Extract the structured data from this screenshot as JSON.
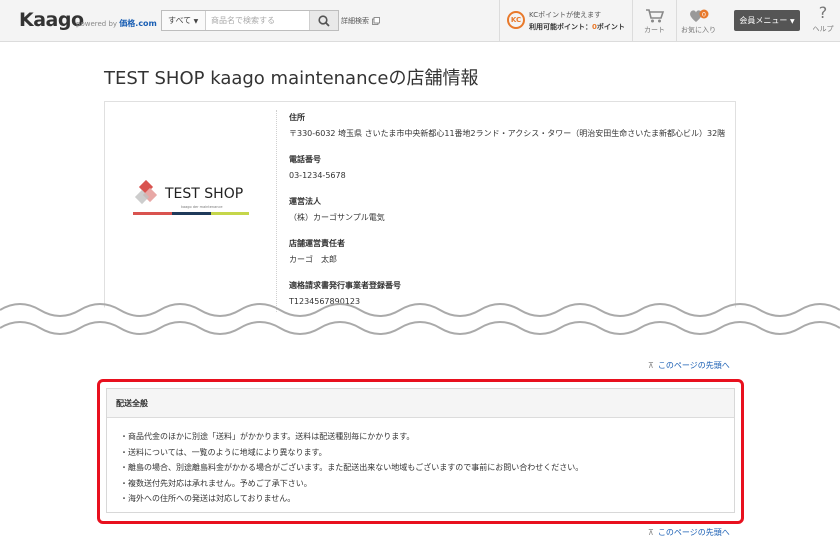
{
  "header": {
    "logo": "Kaago",
    "powered_by": "powered by",
    "powered_brand": "価格.com",
    "search": {
      "category": "すべて",
      "placeholder": "商品名で検索する"
    },
    "advanced_search": "詳細検索",
    "kc": {
      "badge": "KC",
      "line1": "KCポイントが使えます",
      "line2_prefix": "利用可能ポイント：",
      "points": "0",
      "line2_suffix": "ポイント"
    },
    "cart_label": "カート",
    "favorites_label": "お気に入り",
    "favorites_count": "0",
    "member_menu": "会員メニュー",
    "help_label": "ヘルプ"
  },
  "page": {
    "title": "TEST SHOP kaago maintenanceの店舗情報"
  },
  "shop": {
    "logo_text": "TEST SHOP",
    "logo_sub": "kaago der maintenance",
    "info": [
      {
        "label": "住所",
        "value": "〒330-6032 埼玉県 さいたま市中央新都心11番地2ランド・アクシス・タワー（明治安田生命さいたま新都心ビル）32階"
      },
      {
        "label": "電話番号",
        "value": "03-1234-5678"
      },
      {
        "label": "運営法人",
        "value": "（株）カーゴサンプル電気"
      },
      {
        "label": "店舗運営責任者",
        "value": "カーゴ　太郎"
      },
      {
        "label": "適格請求書発行事業者登録番号",
        "value": "T1234567890123"
      }
    ]
  },
  "pagetop_label": "このページの先頭へ",
  "delivery": {
    "heading": "配送全般",
    "items": [
      "・商品代金のほかに別途「送料」がかかります。送料は配送種別毎にかかります。",
      "・送料については、一覧のように地域により異なります。",
      "・離島の場合、別途離島料金がかかる場合がございます。また配送出来ない地域もございますので事前にお問い合わせください。",
      "・複数送付先対応は承れません。予めご了承下さい。",
      "・海外への住所への発送は対応しておりません。"
    ]
  },
  "colors": {
    "accent_orange": "#e8792b",
    "link_blue": "#1a5fb4",
    "highlight_red": "#e8101e",
    "logo_red": "#d9534f",
    "logo_navy": "#1f3a5a",
    "logo_lime": "#c5d64a"
  }
}
